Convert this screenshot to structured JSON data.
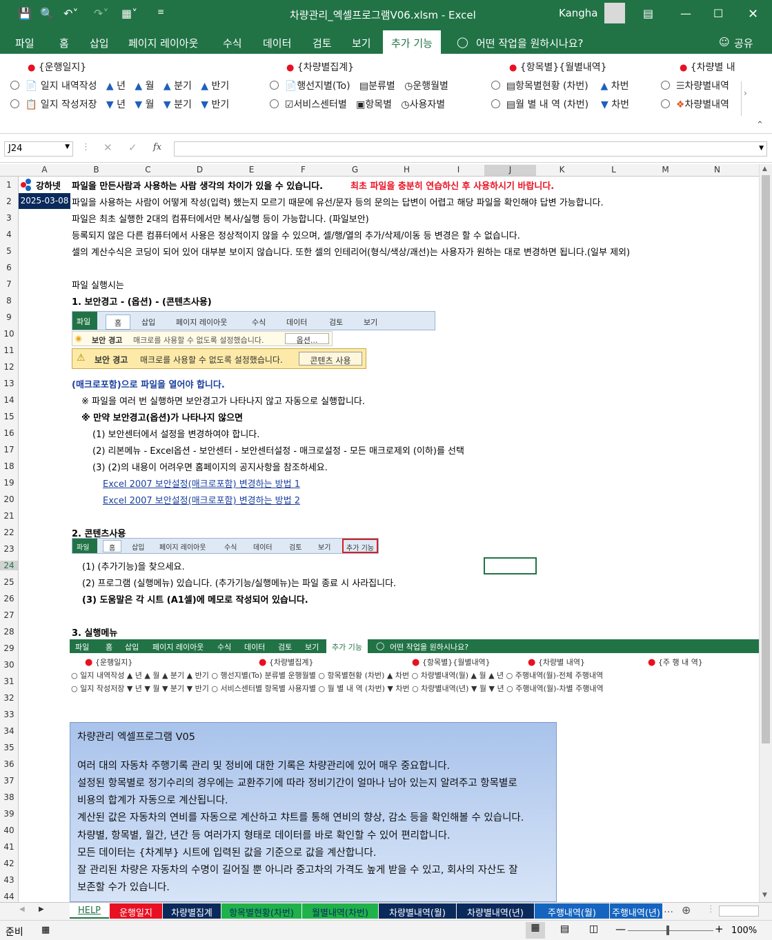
{
  "app": {
    "file_title": "차량관리_엑셀프로그램V06.xlsm  -  Excel",
    "user": "Kangha"
  },
  "tabs": [
    "파일",
    "홈",
    "삽입",
    "페이지 레이아웃",
    "수식",
    "데이터",
    "검토",
    "보기",
    "추가 기능"
  ],
  "tell_me": "어떤 작업을 원하시나요?",
  "share": "공유",
  "ribbon": {
    "groups": [
      {
        "title": "{운행일지}",
        "row1": [
          "일지 내역작성",
          "년",
          "월",
          "분기",
          "반기"
        ],
        "row2": [
          "일지 작성저장",
          "년",
          "월",
          "분기",
          "반기"
        ]
      },
      {
        "title": "{차량별집계}",
        "row1": [
          "행선지별(To)",
          "분류별",
          "운행월별"
        ],
        "row2": [
          "서비스센터별",
          "항목별",
          "사용자별"
        ]
      },
      {
        "title": "{항목별}{월별내역}",
        "row1": [
          "항목별현황 (차번)",
          "차번"
        ],
        "row2": [
          "월 별 내 역 (차번)",
          "차번"
        ]
      },
      {
        "title": "{차량별 내",
        "row1": [
          "차량별내역"
        ],
        "row2": [
          "차량별내역"
        ]
      }
    ]
  },
  "namebox": "J24",
  "columns": [
    "A",
    "B",
    "C",
    "D",
    "E",
    "F",
    "G",
    "H",
    "I",
    "J",
    "K",
    "L",
    "M",
    "N"
  ],
  "rows": [
    "1",
    "2",
    "3",
    "4",
    "5",
    "6",
    "7",
    "8",
    "9",
    "10",
    "11",
    "12",
    "13",
    "14",
    "15",
    "16",
    "17",
    "18",
    "19",
    "20",
    "21",
    "22",
    "23",
    "24",
    "25",
    "26",
    "27",
    "28",
    "29",
    "30",
    "31",
    "32",
    "33",
    "34",
    "35",
    "36",
    "37",
    "38",
    "39",
    "40",
    "41",
    "42",
    "43",
    "44"
  ],
  "logo_text": "강하넷",
  "date": "2025-03-08",
  "lines": {
    "r1a": "파일을 만든사람과 사용하는 사람 생각의 차이가 있을 수 있습니다.",
    "r1b": "최초 파일을 충분히 연습하신 후 사용하시기 바랍니다.",
    "r2": "파일을 사용하는 사람이 어떻게 작성(입력) 했는지 모르기 때문에 유선/문자 등의 문의는 답변이 어렵고 해당 파일을 확인해야 답변 가능합니다.",
    "r3": "파일은 최초 실행한 2대의 컴퓨터에서만 복사/실행 등이 가능합니다.  (파일보안)",
    "r4": "등록되지 않은 다른 컴퓨터에서 사용은 정상적이지 않을 수 있으며, 셀/행/열의 추가/삭제/이동 등 변경은 할 수 없습니다.",
    "r5": "셀의 계산수식은 코딩이 되어 있어 대부분 보이지 않습니다. 또한 셀의 인테리어(형식/색상/괘선)는 사용자가 원하는 대로 변경하면 됩니다.(일부 제외)",
    "r7": "파일 실행시는",
    "r8": "1. 보안경고 - (옵션) - (콘텐츠사용)",
    "r13": "(매크로포함)으로 파일을 열어야 합니다.",
    "r14": "※ 파일을 여러 번 실행하면 보안경고가 나타나지 않고 자동으로 실행합니다.",
    "r15": "※ 만약 보안경고(옵션)가 나타나지 않으면",
    "r16": "(1) 보안센터에서 설정을 변경하여야 합니다.",
    "r17": "(2) 리본메뉴 - Excel옵션 - 보안센터 - 보안센터설정 - 매크로설정 - 모든 매크로제외 (이하)를 선택",
    "r18": "(3) (2)의 내용이 어려우면 홈페이지의 공지사항을 참조하세요.",
    "r19": "Excel 2007 보안설정(매크로포함) 변경하는 방법 1",
    "r20": "Excel 2007 보안설정(매크로포함) 변경하는 방법 2",
    "r22": "2. 콘텐츠사용",
    "r24": "(1) (추가기능)을 찾으세요.",
    "r25": "(2) 프로그램 (실행메뉴) 있습니다. (추가기능/실행메뉴)는 파일 종료 시 사라집니다.",
    "r26": "(3) 도움말은 각 시트 (A1셀)에 메모로 작성되어 있습니다.",
    "r28": "3. 실행메뉴"
  },
  "img1": {
    "tabs": [
      "파일",
      "홈",
      "삽입",
      "페이지 레이아웃",
      "수식",
      "데이터",
      "검토",
      "보기"
    ],
    "warn": "보안 경고",
    "msg": "매크로를 사용할 수 없도록 설정했습니다.",
    "opt": "옵션..."
  },
  "img2": {
    "warn": "보안 경고",
    "msg": "매크로를 사용할 수 없도록 설정했습니다.",
    "btn": "콘텐츠 사용"
  },
  "img3": {
    "tabs": [
      "파일",
      "홈",
      "삽입",
      "페이지 레이아웃",
      "수식",
      "데이터",
      "검토",
      "보기",
      "추가 기능"
    ]
  },
  "img4": {
    "tabs": [
      "파일",
      "홈",
      "삽입",
      "페이지 레이아웃",
      "수식",
      "데이터",
      "검토",
      "보기",
      "추가 기능"
    ],
    "tell": "어떤 작업을 원하시나요?",
    "g1": "{운행일지}",
    "g2": "{차량별집계}",
    "g3": "{항목별}{월별내역}",
    "g4": "{차량별 내역}",
    "g5": "{주 행 내 역}",
    "row1": "일지 내역작성   ▲ 년  ▲ 월  ▲ 분기  ▲ 반기  ○ 행선지별(To)  분류별  운행월별  ○ 항목별현황 (차번)  ▲ 차번  ○ 차량별내역(월)  ▲ 월  ▲ 년  ○ 주행내역(월)-전체  주행내역",
    "row2": "일지 작성저장   ▼ 년  ▼ 월  ▼ 분기  ▼ 반기  ○ 서비스센터별  항목별  사용자별  ○ 월 별 내 역 (차번)  ▼ 차번  ○ 차량별내역(년)  ▼ 월  ▼ 년  ○ 주행내역(월)-차별  주행내역"
  },
  "memo": [
    "차량관리 엑셀프로그램 V05",
    "",
    "여러 대의 자동차 주행기록 관리 및 정비에 대한 기록은 차량관리에 있어 매우 중요합니다.",
    "설정된 항목별로 정기수리의 경우에는 교환주기에 따라 정비기간이 얼마나 남아 있는지 알려주고 항목별로",
    "비용의 합계가 자동으로 계산됩니다.",
    "계산된 값은 자동차의 연비를 자동으로 계산하고 챠트를 통해 연비의 향상, 감소 등을 확인해볼 수 있습니다.",
    "차량별, 항목별, 월간, 년간 등 여러가지 형태로 데이터를 바로 확인할 수 있어 편리합니다.",
    "모든 데이터는 {차계부} 시트에 입력된 값을 기준으로 값을 계산합니다.",
    "잘 관리된 차량은 자동차의 수명이 길어질 뿐 아니라 중고차의 가격도 높게 받을 수 있고, 회사의 자산도 잘",
    "보존할 수가 있습니다."
  ],
  "sheets": [
    {
      "name": "HELP",
      "bg": "#ffffff",
      "fg": "#217346"
    },
    {
      "name": "운행일지",
      "bg": "#e81123",
      "fg": "#ffffff"
    },
    {
      "name": "차량별집계",
      "bg": "#0b2a5c",
      "fg": "#ffffff"
    },
    {
      "name": "항목별현황(차번)",
      "bg": "#1fb24a",
      "fg": "#0b2a5c"
    },
    {
      "name": "월별내역(차번)",
      "bg": "#1fb24a",
      "fg": "#0b2a5c"
    },
    {
      "name": "차량별내역(월)",
      "bg": "#0b2a5c",
      "fg": "#ffffff"
    },
    {
      "name": "차량별내역(년)",
      "bg": "#0b2a5c",
      "fg": "#ffffff"
    },
    {
      "name": "주행내역(월)",
      "bg": "#1565c0",
      "fg": "#ffffff"
    },
    {
      "name": "주행내역(년)",
      "bg": "#1565c0",
      "fg": "#ffffff"
    }
  ],
  "status": {
    "ready": "준비",
    "zoom": "100%"
  },
  "colors": {
    "excel_green": "#217346",
    "red_text": "#e81123"
  }
}
